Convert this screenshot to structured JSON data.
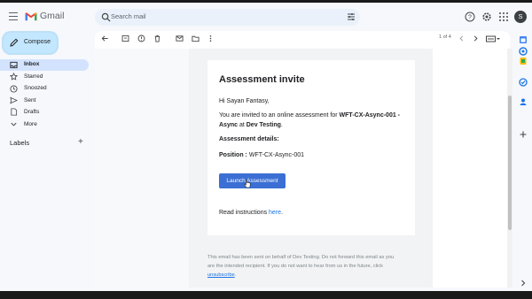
{
  "header": {
    "app_name": "Gmail",
    "search_placeholder": "Search mail",
    "avatar_letter": "S"
  },
  "sidebar": {
    "compose_label": "Compose",
    "items": [
      {
        "label": "Inbox",
        "icon": "inbox-icon",
        "active": true
      },
      {
        "label": "Starred",
        "icon": "star-icon",
        "active": false
      },
      {
        "label": "Snoozed",
        "icon": "clock-icon",
        "active": false
      },
      {
        "label": "Sent",
        "icon": "send-icon",
        "active": false
      },
      {
        "label": "Drafts",
        "icon": "file-icon",
        "active": false
      },
      {
        "label": "More",
        "icon": "chevron-down-icon",
        "active": false
      }
    ],
    "labels_title": "Labels"
  },
  "toolbar": {
    "pager": "1 of 4"
  },
  "email": {
    "title": "Assessment invite",
    "greeting": "Hi Sayan Fantasy,",
    "intro_prefix": "You are invited to an online assessment for ",
    "assessment_name_line1": "WFT-CX-Async-001 -",
    "assessment_name_line2": "Async",
    "at_text": " at ",
    "company": "Dev Testing",
    "period": ".",
    "details_heading": "Assessment details:",
    "position_label": "Position :",
    "position_value": " WFT-CX-Async-001",
    "button_label": "Launch Assessment",
    "instructions_prefix": "Read instructions ",
    "instructions_link": "here",
    "footer_line1": "This email has been sent on behalf of Dev Testing. Do not forward this email as you",
    "footer_line2": "are the intended recipient. If you do not want to hear from us in the future, click",
    "footer_link": "unsubscribe",
    "footer_end": "."
  },
  "colors": {
    "accent": "#3b6fd4",
    "compose_bg": "#c2e7ff",
    "active_nav": "#d3e3fd"
  }
}
